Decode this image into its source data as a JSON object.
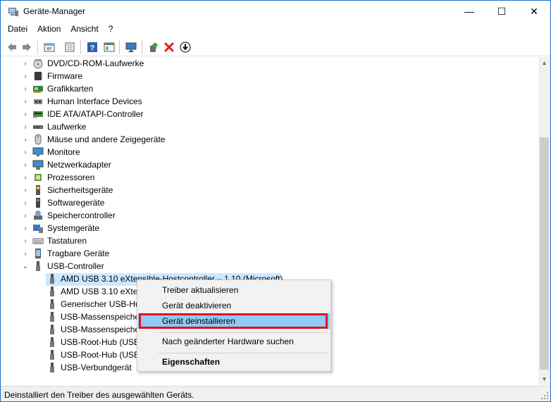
{
  "window": {
    "title": "Geräte-Manager",
    "minimize_glyph": "—",
    "maximize_glyph": "☐",
    "close_glyph": "✕"
  },
  "menu": [
    "Datei",
    "Aktion",
    "Ansicht",
    "?"
  ],
  "toolbar": {
    "buttons": [
      "back-icon",
      "forward-icon",
      "properties-icon",
      "show-hide-icon",
      "help-icon",
      "view-icon",
      "monitor-icon",
      "update-driver-icon",
      "uninstall-icon",
      "scan-icon"
    ]
  },
  "tree": {
    "categories": [
      {
        "label": "DVD/CD-ROM-Laufwerke",
        "icon": "dvd-icon"
      },
      {
        "label": "Firmware",
        "icon": "firmware-icon"
      },
      {
        "label": "Grafikkarten",
        "icon": "display-adapter-icon"
      },
      {
        "label": "Human Interface Devices",
        "icon": "hid-icon"
      },
      {
        "label": "IDE ATA/ATAPI-Controller",
        "icon": "ide-icon"
      },
      {
        "label": "Laufwerke",
        "icon": "disk-icon"
      },
      {
        "label": "Mäuse und andere Zeigegeräte",
        "icon": "mouse-icon"
      },
      {
        "label": "Monitore",
        "icon": "monitor-icon"
      },
      {
        "label": "Netzwerkadapter",
        "icon": "network-icon"
      },
      {
        "label": "Prozessoren",
        "icon": "processor-icon"
      },
      {
        "label": "Sicherheitsgeräte",
        "icon": "security-icon"
      },
      {
        "label": "Softwaregeräte",
        "icon": "software-device-icon"
      },
      {
        "label": "Speichercontroller",
        "icon": "storage-controller-icon"
      },
      {
        "label": "Systemgeräte",
        "icon": "system-icon"
      },
      {
        "label": "Tastaturen",
        "icon": "keyboard-icon"
      },
      {
        "label": "Tragbare Geräte",
        "icon": "portable-icon"
      },
      {
        "label": "USB-Controller",
        "icon": "usb-icon"
      }
    ],
    "usb_children": [
      "AMD USB 3.10 eXtensible-Hostcontroller – 1.10 (Microsoft)",
      "AMD USB 3.10 eXtensible-Hostcontroller – 1.10 (Microsoft)",
      "Generischer USB-Hub",
      "USB-Massenspeichergerät",
      "USB-Massenspeichergerät",
      "USB-Root-Hub (USB 3.0)",
      "USB-Root-Hub (USB 3.0)",
      "USB-Verbundgerät"
    ],
    "expanded_glyph": "⌄",
    "collapsed_glyph": "›"
  },
  "context_menu": {
    "items": [
      "Treiber aktualisieren",
      "Gerät deaktivieren",
      "Gerät deinstallieren",
      "Nach geänderter Hardware suchen",
      "Eigenschaften"
    ]
  },
  "status": {
    "text": "Deinstalliert den Treiber des ausgewählten Geräts."
  },
  "colors": {
    "selection": "#cce8ff",
    "menu_highlight": "#91c9f7",
    "red_marker": "#e5101b",
    "accent": "#1e6fc9"
  }
}
